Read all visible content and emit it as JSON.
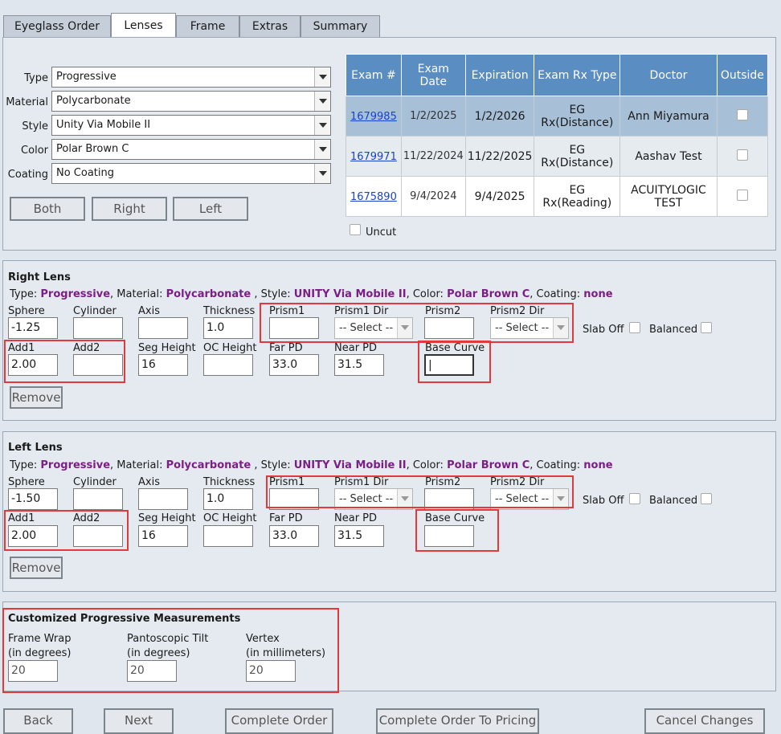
{
  "tabs": [
    "Eyeglass Order",
    "Lenses",
    "Frame",
    "Extras",
    "Summary"
  ],
  "lens_selection": {
    "type_label": "Type",
    "type_value": "Progressive",
    "material_label": "Material",
    "material_value": "Polycarbonate",
    "style_label": "Style",
    "style_value": "Unity Via Mobile II",
    "color_label": "Color",
    "color_value": "Polar Brown C",
    "coating_label": "Coating",
    "coating_value": "No Coating",
    "both_label": "Both",
    "right_label": "Right",
    "left_label": "Left"
  },
  "exam_table": {
    "headers": [
      "Exam #",
      "Exam Date",
      "Expiration",
      "Exam Rx Type",
      "Doctor",
      "Outside"
    ],
    "rows": [
      {
        "exam": "1679985",
        "date": "1/2/2025",
        "expiration": "1/2/2026",
        "rx_type": "EG Rx(Distance)",
        "doctor": "Ann Miyamura"
      },
      {
        "exam": "1679971",
        "date": "11/22/2024",
        "expiration": "11/22/2025",
        "rx_type": "EG Rx(Distance)",
        "doctor": "Aashav Test"
      },
      {
        "exam": "1675890",
        "date": "9/4/2024",
        "expiration": "9/4/2025",
        "rx_type": "EG Rx(Reading)",
        "doctor": "ACUITYLOGIC TEST"
      }
    ],
    "uncut_label": "Uncut"
  },
  "desc_labels": {
    "type": "Type:",
    "material": ", Material:",
    "style": ", Style:",
    "color": ", Color:",
    "coating": ", Coating:"
  },
  "right_lens": {
    "title": "Right Lens",
    "desc": {
      "type": "Progressive",
      "material": "Polycarbonate",
      "style": "UNITY Via Mobile II",
      "color": "Polar Brown C",
      "coating": "none"
    },
    "sphere": "-1.25",
    "cylinder": "",
    "axis": "",
    "thickness": "1.0",
    "prism1": "",
    "prism1_dir": "-- Select --",
    "prism2": "",
    "prism2_dir": "-- Select --",
    "add1": "2.00",
    "add2": "",
    "seg_height": "16",
    "oc_height": "",
    "far_pd": "33.0",
    "near_pd": "31.5",
    "base_curve": "|",
    "remove_label": "Remove"
  },
  "left_lens": {
    "title": "Left Lens",
    "desc": {
      "type": "Progressive",
      "material": "Polycarbonate",
      "style": "UNITY Via Mobile II",
      "color": "Polar Brown C",
      "coating": "none"
    },
    "sphere": "-1.50",
    "cylinder": "",
    "axis": "",
    "thickness": "1.0",
    "prism1": "",
    "prism1_dir": "-- Select --",
    "prism2": "",
    "prism2_dir": "-- Select --",
    "add1": "2.00",
    "add2": "",
    "seg_height": "16",
    "oc_height": "",
    "far_pd": "33.0",
    "near_pd": "31.5",
    "base_curve": "",
    "remove_label": "Remove"
  },
  "field_labels": {
    "sphere": "Sphere",
    "cylinder": "Cylinder",
    "axis": "Axis",
    "thickness": "Thickness",
    "prism1": "Prism1",
    "prism1_dir": "Prism1 Dir",
    "prism2": "Prism2",
    "prism2_dir": "Prism2 Dir",
    "slab_off": "Slab Off",
    "balanced": "Balanced",
    "add1": "Add1",
    "add2": "Add2",
    "seg_height": "Seg Height",
    "oc_height": "OC Height",
    "far_pd": "Far PD",
    "near_pd": "Near PD",
    "base_curve": "Base Curve"
  },
  "progressive": {
    "title": "Customized Progressive Measurements",
    "frame_wrap_label": "Frame Wrap",
    "frame_wrap_unit": "(in degrees)",
    "frame_wrap_value": "20",
    "pantoscopic_label": "Pantoscopic Tilt",
    "pantoscopic_unit": "(in degrees)",
    "pantoscopic_value": "20",
    "vertex_label": "Vertex",
    "vertex_unit": "(in millimeters)",
    "vertex_value": "20"
  },
  "footer": {
    "back": "Back",
    "next": "Next",
    "complete_order": "Complete Order",
    "complete_pricing": "Complete Order To Pricing",
    "cancel": "Cancel Changes"
  }
}
